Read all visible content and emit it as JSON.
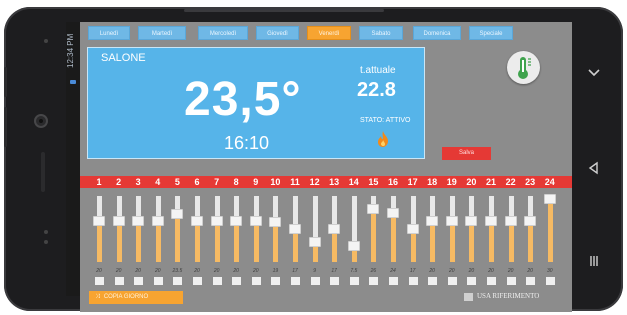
{
  "statusbar": {
    "time": "12:34 PM"
  },
  "days": [
    {
      "label": "Lunedì",
      "active": false
    },
    {
      "label": "Martedì",
      "active": false
    },
    {
      "label": "Mercoledì",
      "active": false
    },
    {
      "label": "Giovedì",
      "active": false
    },
    {
      "label": "Venerdì",
      "active": true
    },
    {
      "label": "Sabato",
      "active": false
    },
    {
      "label": "Domenica",
      "active": false
    },
    {
      "label": "Speciale",
      "active": false
    }
  ],
  "panel": {
    "room": "SALONE",
    "set_temp": "23,5°",
    "time": "16:10",
    "tattuale_label": "t.attuale",
    "tattuale_value": "22.8",
    "stato": "STATO: ATTIVO"
  },
  "save_label": "Salva",
  "hours": [
    "1",
    "2",
    "3",
    "4",
    "5",
    "6",
    "7",
    "8",
    "9",
    "10",
    "11",
    "12",
    "13",
    "14",
    "15",
    "16",
    "17",
    "18",
    "19",
    "20",
    "21",
    "22",
    "23",
    "24"
  ],
  "sliders": [
    {
      "label": "20",
      "level": 0.62
    },
    {
      "label": "20",
      "level": 0.62
    },
    {
      "label": "20",
      "level": 0.62
    },
    {
      "label": "20",
      "level": 0.62
    },
    {
      "label": "23.5",
      "level": 0.72
    },
    {
      "label": "20",
      "level": 0.62
    },
    {
      "label": "20",
      "level": 0.62
    },
    {
      "label": "20",
      "level": 0.62
    },
    {
      "label": "20",
      "level": 0.62
    },
    {
      "label": "19",
      "level": 0.6
    },
    {
      "label": "17",
      "level": 0.5
    },
    {
      "label": "9",
      "level": 0.3
    },
    {
      "label": "17",
      "level": 0.5
    },
    {
      "label": "7.5",
      "level": 0.25
    },
    {
      "label": "26",
      "level": 0.8
    },
    {
      "label": "24",
      "level": 0.74
    },
    {
      "label": "17",
      "level": 0.5
    },
    {
      "label": "20",
      "level": 0.62
    },
    {
      "label": "20",
      "level": 0.62
    },
    {
      "label": "20",
      "level": 0.62
    },
    {
      "label": "20",
      "level": 0.62
    },
    {
      "label": "20",
      "level": 0.62
    },
    {
      "label": "20",
      "level": 0.62
    },
    {
      "label": "30",
      "level": 0.95
    }
  ],
  "copy_label": "COPIA GIORNO",
  "rif_label": "USA RIFERIMENTO",
  "icons": {
    "thermostat": "thermostat-icon",
    "flame": "flame-icon",
    "copy": "shuffle-icon",
    "nav_back": "chevron-down-icon",
    "nav_home": "triangle-icon",
    "nav_recent": "recent-apps-icon"
  },
  "colors": {
    "accent_blue": "#56b4e9",
    "accent_orange": "#f7a431",
    "accent_red": "#e53935",
    "screen_gray": "#8c8c8c"
  }
}
